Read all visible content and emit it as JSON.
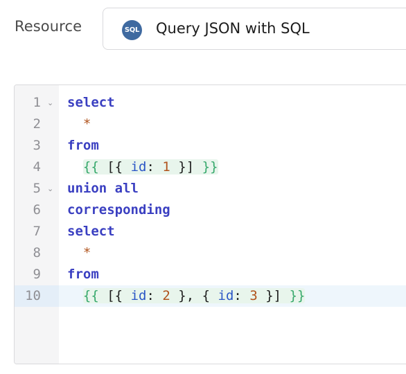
{
  "resource": {
    "label": "Resource",
    "badge": "SQL",
    "name": "Query JSON with SQL"
  },
  "editor": {
    "active_line": 10,
    "lines": [
      {
        "num": "1",
        "fold": "v"
      },
      {
        "num": "2"
      },
      {
        "num": "3"
      },
      {
        "num": "4"
      },
      {
        "num": "5",
        "fold": "v"
      },
      {
        "num": "6"
      },
      {
        "num": "7"
      },
      {
        "num": "8"
      },
      {
        "num": "9"
      },
      {
        "num": "10"
      }
    ],
    "tokens": {
      "l1": "select",
      "l2": "*",
      "l3": "from",
      "l4": [
        "{{",
        "[{",
        "id",
        ":",
        "1",
        "}]",
        "}}"
      ],
      "l5": "union all",
      "l6": "corresponding",
      "l7": "select",
      "l8": "*",
      "l9": "from",
      "l10": [
        "{{",
        "[{",
        "id",
        ":",
        "2",
        "},",
        "{",
        "id",
        ":",
        "3",
        "}]",
        "}}"
      ]
    }
  },
  "colors": {
    "keyword": "#3a3fc1",
    "operator": "#b0531c",
    "template_brace": "#35a86b",
    "object_key": "#2a56c6",
    "number": "#b0531c",
    "sql_badge": "#3f6aa0",
    "active_line": "#eef6fc"
  },
  "icons": {
    "resource_icon": "sql-badge-icon",
    "fold_icon": "chevron-down-icon"
  }
}
